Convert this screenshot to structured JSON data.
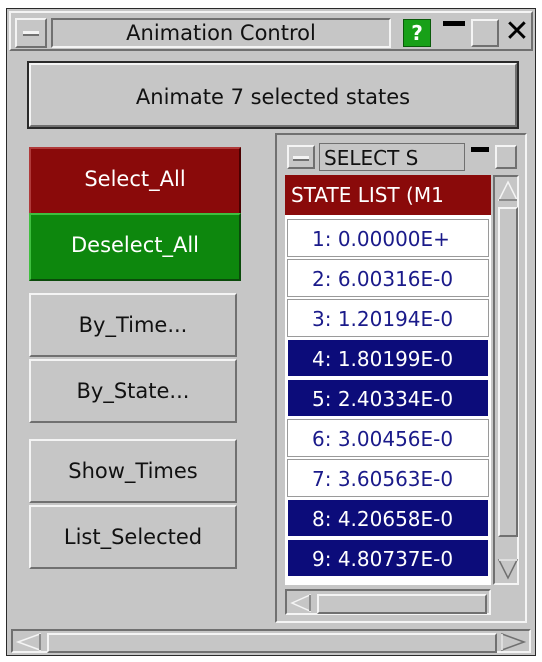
{
  "window": {
    "title": "Animation Control",
    "help_label": "?",
    "close_label": "✕"
  },
  "animate_button": {
    "label": "Animate 7 selected states"
  },
  "left_buttons": [
    {
      "label": "Select_All"
    },
    {
      "label": "Deselect_All"
    },
    {
      "label": "By_Time..."
    },
    {
      "label": "By_State..."
    },
    {
      "label": "Show_Times"
    },
    {
      "label": "List_Selected"
    }
  ],
  "select_panel": {
    "title": "SELECT S",
    "list_header": "STATE LIST (M1",
    "rows": [
      {
        "text": "1: 0.00000E+",
        "selected": false
      },
      {
        "text": "2: 6.00316E-0",
        "selected": false
      },
      {
        "text": "3: 1.20194E-0",
        "selected": false
      },
      {
        "text": "4: 1.80199E-0",
        "selected": true
      },
      {
        "text": "5: 2.40334E-0",
        "selected": true
      },
      {
        "text": "6: 3.00456E-0",
        "selected": false
      },
      {
        "text": "7: 3.60563E-0",
        "selected": false
      },
      {
        "text": "8: 4.20658E-0",
        "selected": true
      },
      {
        "text": "9: 4.80737E-0",
        "selected": true
      }
    ]
  },
  "colors": {
    "panel_bg": "#c6c6c6",
    "select_all_bg": "#8a0a0a",
    "deselect_all_bg": "#0d870d",
    "selected_row_bg": "#0c0c7a",
    "unselected_row_text": "#1a1a8a",
    "help_bg": "#18a018"
  }
}
